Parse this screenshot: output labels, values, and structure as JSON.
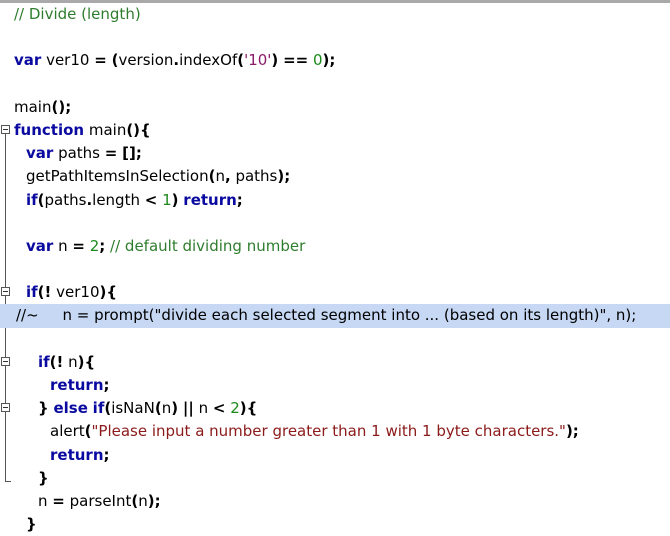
{
  "editor": {
    "lines": [
      {
        "indent": 0,
        "tokens": [
          [
            "cmt",
            "// Divide (length)"
          ]
        ]
      },
      {
        "indent": 0,
        "tokens": []
      },
      {
        "indent": 0,
        "tokens": [
          [
            "kw",
            "var"
          ],
          [
            "",
            " ver10 "
          ],
          [
            "pu",
            "="
          ],
          [
            "",
            " "
          ],
          [
            "pu",
            "("
          ],
          [
            "",
            "version"
          ],
          [
            "pu",
            "."
          ],
          [
            "",
            "indexOf"
          ],
          [
            "pu",
            "("
          ],
          [
            "str",
            "'10'"
          ],
          [
            "pu",
            ")"
          ],
          [
            "",
            " "
          ],
          [
            "pu",
            "=="
          ],
          [
            "",
            " "
          ],
          [
            "num",
            "0"
          ],
          [
            "pu",
            ");"
          ]
        ]
      },
      {
        "indent": 0,
        "tokens": []
      },
      {
        "indent": 0,
        "tokens": [
          [
            "",
            "main"
          ],
          [
            "pu",
            "();"
          ]
        ]
      },
      {
        "indent": 0,
        "fold": true,
        "tokens": [
          [
            "kw",
            "function"
          ],
          [
            "",
            " main"
          ],
          [
            "pu",
            "(){"
          ]
        ]
      },
      {
        "indent": 1,
        "tokens": [
          [
            "kw",
            "var"
          ],
          [
            "",
            " paths "
          ],
          [
            "pu",
            "="
          ],
          [
            "",
            " "
          ],
          [
            "pu",
            "[];"
          ]
        ]
      },
      {
        "indent": 1,
        "tokens": [
          [
            "",
            "getPathItemsInSelection"
          ],
          [
            "pu",
            "("
          ],
          [
            "",
            "n"
          ],
          [
            "pu",
            ","
          ],
          [
            "",
            " paths"
          ],
          [
            "pu",
            ");"
          ]
        ]
      },
      {
        "indent": 1,
        "tokens": [
          [
            "kw",
            "if"
          ],
          [
            "pu",
            "("
          ],
          [
            "",
            "paths"
          ],
          [
            "pu",
            "."
          ],
          [
            "",
            "length "
          ],
          [
            "pu",
            "<"
          ],
          [
            "",
            " "
          ],
          [
            "num",
            "1"
          ],
          [
            "pu",
            ")"
          ],
          [
            "",
            " "
          ],
          [
            "kw",
            "return"
          ],
          [
            "pu",
            ";"
          ]
        ]
      },
      {
        "indent": 0,
        "tokens": []
      },
      {
        "indent": 1,
        "tokens": [
          [
            "kw",
            "var"
          ],
          [
            "",
            " n "
          ],
          [
            "pu",
            "="
          ],
          [
            "",
            " "
          ],
          [
            "num",
            "2"
          ],
          [
            "pu",
            ";"
          ],
          [
            "",
            " "
          ],
          [
            "cmt",
            "// default dividing number"
          ]
        ]
      },
      {
        "indent": 0,
        "tokens": []
      },
      {
        "indent": 1,
        "fold": true,
        "tokens": [
          [
            "kw",
            "if"
          ],
          [
            "pu",
            "(!"
          ],
          [
            "",
            " ver10"
          ],
          [
            "pu",
            "){"
          ]
        ]
      },
      {
        "indent": 0,
        "selected": true,
        "offset": 16,
        "tokens": [
          [
            "",
            "//~     n = prompt(\"divide each selected segment into ... (based on its length)\", n);"
          ]
        ]
      },
      {
        "indent": 0,
        "tokens": []
      },
      {
        "indent": 2,
        "fold": true,
        "tokens": [
          [
            "kw",
            "if"
          ],
          [
            "pu",
            "(!"
          ],
          [
            "",
            " n"
          ],
          [
            "pu",
            "){"
          ]
        ]
      },
      {
        "indent": 3,
        "tokens": [
          [
            "kw",
            "return"
          ],
          [
            "pu",
            ";"
          ]
        ]
      },
      {
        "indent": 2,
        "fold": true,
        "tokens": [
          [
            "pu",
            "}"
          ],
          [
            "",
            " "
          ],
          [
            "kw",
            "else"
          ],
          [
            "",
            " "
          ],
          [
            "kw",
            "if"
          ],
          [
            "pu",
            "("
          ],
          [
            "",
            "isNaN"
          ],
          [
            "pu",
            "("
          ],
          [
            "",
            "n"
          ],
          [
            "pu",
            ")"
          ],
          [
            "",
            " "
          ],
          [
            "pu",
            "||"
          ],
          [
            "",
            " n "
          ],
          [
            "pu",
            "<"
          ],
          [
            "",
            " "
          ],
          [
            "num",
            "2"
          ],
          [
            "pu",
            "){"
          ]
        ]
      },
      {
        "indent": 3,
        "tokens": [
          [
            "",
            "alert"
          ],
          [
            "pu",
            "("
          ],
          [
            "dstr",
            "\"Please input a number greater than 1 with 1 byte characters.\""
          ],
          [
            "pu",
            ");"
          ]
        ]
      },
      {
        "indent": 3,
        "tokens": [
          [
            "kw",
            "return"
          ],
          [
            "pu",
            ";"
          ]
        ]
      },
      {
        "indent": 2,
        "tokens": [
          [
            "pu",
            "}"
          ]
        ]
      },
      {
        "indent": 2,
        "tokens": [
          [
            "",
            "n "
          ],
          [
            "pu",
            "="
          ],
          [
            "",
            " parseInt"
          ],
          [
            "pu",
            "("
          ],
          [
            "",
            "n"
          ],
          [
            "pu",
            ");"
          ]
        ]
      },
      {
        "indent": 1,
        "tokens": [
          [
            "pu",
            "}"
          ]
        ]
      }
    ]
  }
}
